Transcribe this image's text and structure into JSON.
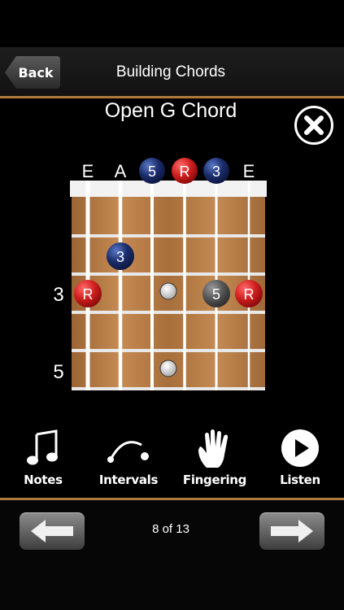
{
  "header": {
    "back_label": "Back",
    "title": "Building Chords"
  },
  "chord": {
    "title": "Open G Chord"
  },
  "strings": {
    "names": [
      "E",
      "A",
      "5",
      "R",
      "3",
      "E"
    ],
    "open_marker_colors": [
      "none",
      "none",
      "#1b2d6b",
      "#d11e1e",
      "#1b2d6b",
      "none"
    ]
  },
  "fret_labels": {
    "first": "3",
    "second": "5"
  },
  "notes": [
    {
      "label": "3",
      "string": 2,
      "fret": 2,
      "color": "#1b2d6b"
    },
    {
      "label": "R",
      "string": 1,
      "fret": 3,
      "color": "#d11e1e"
    },
    {
      "label": "5",
      "string": 5,
      "fret": 3,
      "color": "#555555"
    },
    {
      "label": "R",
      "string": 6,
      "fret": 3,
      "color": "#d11e1e"
    }
  ],
  "toolbar": {
    "notes": "Notes",
    "intervals": "Intervals",
    "fingering": "Fingering",
    "listen": "Listen"
  },
  "pagination": {
    "text": "8 of 13"
  },
  "colors": {
    "accent": "#b07a3f",
    "root": "#d11e1e",
    "interval": "#1b2d6b",
    "fret_wood": "#b57c45"
  }
}
